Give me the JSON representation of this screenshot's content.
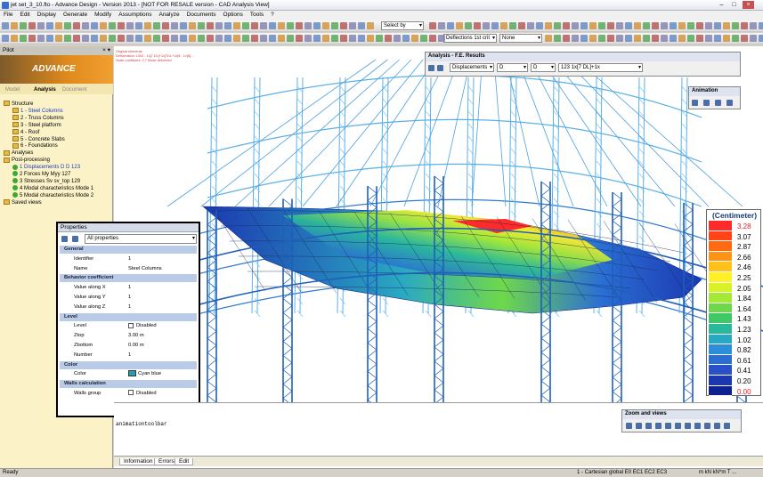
{
  "window": {
    "title": "jet set_3_10.fto - Advance Design - Version 2013 - [NOT FOR RESALE version - CAD Analysis View]",
    "min": "–",
    "max": "□",
    "close": "×"
  },
  "menu": [
    "File",
    "Edit",
    "Display",
    "Generate",
    "Modify",
    "Assumptions",
    "Analyze",
    "Documents",
    "Options",
    "Tools",
    "?"
  ],
  "toolbar": {
    "select_by": "Select by",
    "deflections": "Deflections 1st crit",
    "deflections_val": "None"
  },
  "pilot": {
    "title": "Pilot",
    "logo": "ADVANCE",
    "tabs": [
      "Model",
      "Analysis",
      "Document"
    ],
    "tree": [
      {
        "label": "Structure",
        "kind": "fold",
        "indent": 0
      },
      {
        "label": "1 - Steel Columns",
        "kind": "fold",
        "indent": 1,
        "selected": true
      },
      {
        "label": "2 - Truss Columns",
        "kind": "fold",
        "indent": 1
      },
      {
        "label": "3 - Steel platform",
        "kind": "fold",
        "indent": 1
      },
      {
        "label": "4 - Roof",
        "kind": "fold",
        "indent": 1
      },
      {
        "label": "5 - Concrete Slabs",
        "kind": "fold",
        "indent": 1
      },
      {
        "label": "6 - Foundations",
        "kind": "fold",
        "indent": 1
      },
      {
        "label": "Analyses",
        "kind": "fold",
        "indent": 0
      },
      {
        "label": "Post-processing",
        "kind": "fold",
        "indent": 0
      },
      {
        "label": "1 Displacements D  D 123",
        "kind": "dot",
        "indent": 1,
        "selected": true
      },
      {
        "label": "2 Forces My  Myy 127",
        "kind": "dot",
        "indent": 1
      },
      {
        "label": "3 Stresses Sv  sv_top  129",
        "kind": "dot",
        "indent": 1
      },
      {
        "label": "4 Modal characteristics Mode 1",
        "kind": "dot",
        "indent": 1
      },
      {
        "label": "5 Modal characteristics Mode 2",
        "kind": "dot",
        "indent": 1
      },
      {
        "label": "Saved views",
        "kind": "fold",
        "indent": 0
      }
    ]
  },
  "properties": {
    "title": "Properties",
    "filter": "All properties",
    "rows": [
      {
        "type": "section",
        "label": "General"
      },
      {
        "type": "row",
        "k": "Identifier",
        "v": "1"
      },
      {
        "type": "row",
        "k": "Name",
        "v": "Steel Columns"
      },
      {
        "type": "section",
        "label": "Behavior coefficient"
      },
      {
        "type": "row",
        "k": "Value along X",
        "v": "1"
      },
      {
        "type": "row",
        "k": "Value along Y",
        "v": "1"
      },
      {
        "type": "row",
        "k": "Value along Z",
        "v": "1"
      },
      {
        "type": "section",
        "label": "Level"
      },
      {
        "type": "row",
        "k": "Level",
        "v": "Disabled"
      },
      {
        "type": "row",
        "k": "Ztop",
        "v": "3.00 m"
      },
      {
        "type": "row",
        "k": "Zbottom",
        "v": "0.00 m"
      },
      {
        "type": "row",
        "k": "Number",
        "v": "1"
      },
      {
        "type": "section",
        "label": "Color"
      },
      {
        "type": "row",
        "k": "Color",
        "v": "Cyan blue"
      },
      {
        "type": "section",
        "label": "Walls calculation"
      },
      {
        "type": "row",
        "k": "Walls group",
        "v": "Disabled"
      }
    ]
  },
  "results_toolbar": {
    "title": "Analysis - F.E. Results",
    "type": "Displacements",
    "comp1": "D",
    "comp2": "D",
    "case": "123 1x[7 DL]+1x"
  },
  "animation_toolbar": {
    "title": "Animation"
  },
  "zoom_toolbar": {
    "title": "Zoom and views"
  },
  "legend": {
    "title": "(Centimeter)",
    "items": [
      {
        "v": "3.28",
        "c": "#ff2a2a",
        "red": true
      },
      {
        "v": "3.07",
        "c": "#ff4418"
      },
      {
        "v": "2.87",
        "c": "#ff6a12"
      },
      {
        "v": "2.66",
        "c": "#ff9414"
      },
      {
        "v": "2.46",
        "c": "#ffc21a"
      },
      {
        "v": "2.25",
        "c": "#fff02a"
      },
      {
        "v": "2.05",
        "c": "#d8f22a"
      },
      {
        "v": "1.84",
        "c": "#a4e838"
      },
      {
        "v": "1.64",
        "c": "#6fd84a"
      },
      {
        "v": "1.43",
        "c": "#3ec866"
      },
      {
        "v": "1.23",
        "c": "#2ab89a"
      },
      {
        "v": "1.02",
        "c": "#2aa8c2"
      },
      {
        "v": "0.82",
        "c": "#2a8ed8"
      },
      {
        "v": "0.61",
        "c": "#2a6ed4"
      },
      {
        "v": "0.41",
        "c": "#2a50c8"
      },
      {
        "v": "0.20",
        "c": "#1c38b0"
      },
      {
        "v": "0.00",
        "c": "#0d2290",
        "red": true
      }
    ]
  },
  "viewport_note": {
    "l1": "Original elements",
    "l2": "Deformation: 1300 - 1x[7 DL]+1x[7DL+1x[8 - 1x[8]...",
    "l3": "Scale coefficient: 2.7 Mode deformed"
  },
  "command": {
    "line": "animationtoolbar"
  },
  "bottom_tabs": [
    "Information",
    "Errors",
    "Edit"
  ],
  "status": {
    "left": "Ready",
    "coords": "1 - Cartesian global  E0  EC1  EC2  EC3",
    "units": "m  kN  kN*m  T  ..."
  }
}
